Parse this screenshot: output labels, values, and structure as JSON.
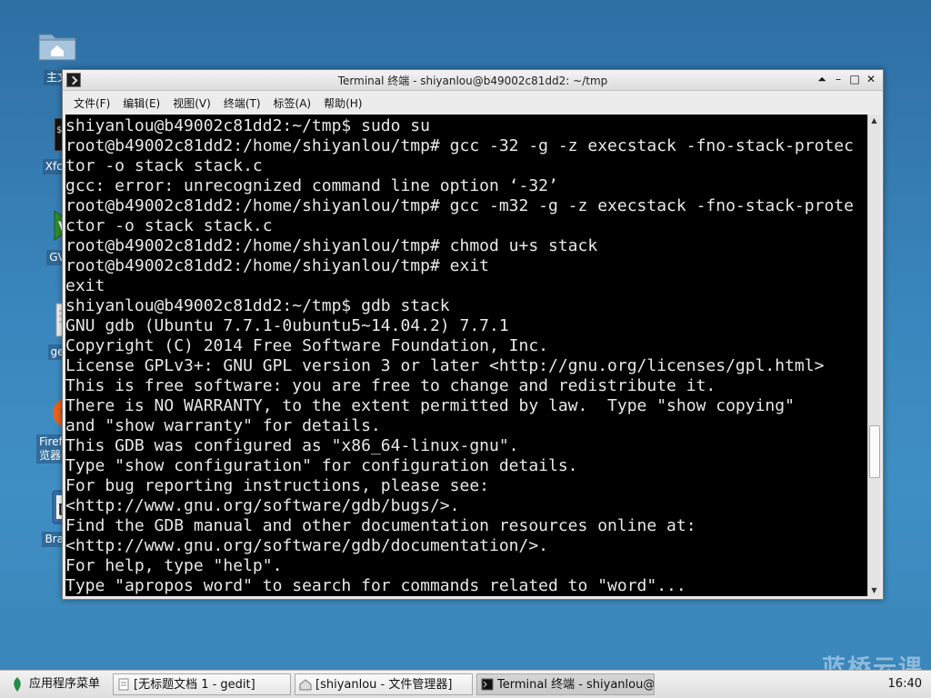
{
  "desktop": {
    "icons": [
      {
        "label": "主文"
      },
      {
        "label": "Xfce"
      },
      {
        "label": "GV"
      },
      {
        "label": "ge"
      },
      {
        "label": "Firefox\n览器"
      },
      {
        "label": "Brac"
      }
    ]
  },
  "window": {
    "title": "Terminal 终端 - shiyanlou@b49002c81dd2: ~/tmp",
    "controls": [
      "⏶",
      "–",
      "□",
      "✕"
    ],
    "menu": [
      "文件(F)",
      "编辑(E)",
      "视图(V)",
      "终端(T)",
      "标签(A)",
      "帮助(H)"
    ]
  },
  "terminal": {
    "text": "shiyanlou@b49002c81dd2:~/tmp$ sudo su\nroot@b49002c81dd2:/home/shiyanlou/tmp# gcc -32 -g -z execstack -fno-stack-protec\ntor -o stack stack.c\ngcc: error: unrecognized command line option ‘-32’\nroot@b49002c81dd2:/home/shiyanlou/tmp# gcc -m32 -g -z execstack -fno-stack-prote\nctor -o stack stack.c\nroot@b49002c81dd2:/home/shiyanlou/tmp# chmod u+s stack\nroot@b49002c81dd2:/home/shiyanlou/tmp# exit\nexit\nshiyanlou@b49002c81dd2:~/tmp$ gdb stack\nGNU gdb (Ubuntu 7.7.1-0ubuntu5~14.04.2) 7.7.1\nCopyright (C) 2014 Free Software Foundation, Inc.\nLicense GPLv3+: GNU GPL version 3 or later <http://gnu.org/licenses/gpl.html>\nThis is free software: you are free to change and redistribute it.\nThere is NO WARRANTY, to the extent permitted by law.  Type \"show copying\"\nand \"show warranty\" for details.\nThis GDB was configured as \"x86_64-linux-gnu\".\nType \"show configuration\" for configuration details.\nFor bug reporting instructions, please see:\n<http://www.gnu.org/software/gdb/bugs/>.\nFind the GDB manual and other documentation resources online at:\n<http://www.gnu.org/software/gdb/documentation/>.\nFor help, type \"help\".\nType \"apropos word\" to search for commands related to \"word\"..."
  },
  "taskbar": {
    "menu_label": "应用程序菜单",
    "tasks": [
      {
        "label": "[无标题文档 1 - gedit]"
      },
      {
        "label": "[shiyanlou - 文件管理器]"
      },
      {
        "label": "Terminal 终端 - shiyanlou@…"
      }
    ],
    "clock": "16:40",
    "watermark": "蓝桥云课"
  },
  "colors": {
    "desktop_bg": "#3a86bd",
    "terminal_bg": "#000000",
    "terminal_fg": "#e8e8e8"
  }
}
